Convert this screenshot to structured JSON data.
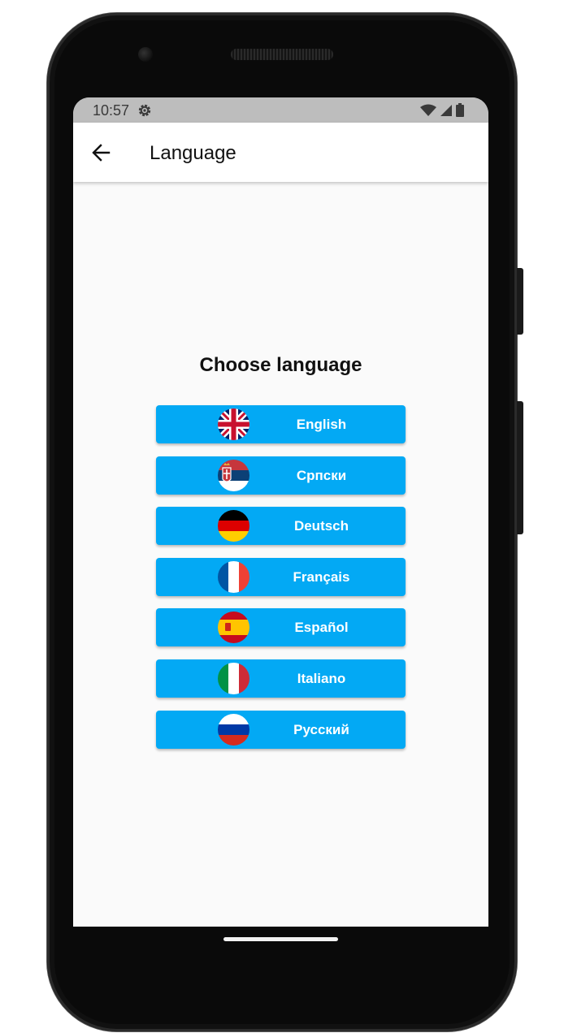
{
  "status_bar": {
    "time": "10:57",
    "icons": [
      "settings-icon",
      "wifi-icon",
      "signal-icon",
      "battery-icon"
    ]
  },
  "app_bar": {
    "back_icon": "arrow-back-icon",
    "title": "Language"
  },
  "main": {
    "heading": "Choose language",
    "accent_color": "#03a9f4",
    "languages": [
      {
        "label": "English",
        "flag": "uk-flag-icon"
      },
      {
        "label": "Српски",
        "flag": "serbia-flag-icon"
      },
      {
        "label": "Deutsch",
        "flag": "germany-flag-icon"
      },
      {
        "label": "Français",
        "flag": "france-flag-icon"
      },
      {
        "label": "Español",
        "flag": "spain-flag-icon"
      },
      {
        "label": "Italiano",
        "flag": "italy-flag-icon"
      },
      {
        "label": "Русский",
        "flag": "russia-flag-icon"
      }
    ]
  }
}
